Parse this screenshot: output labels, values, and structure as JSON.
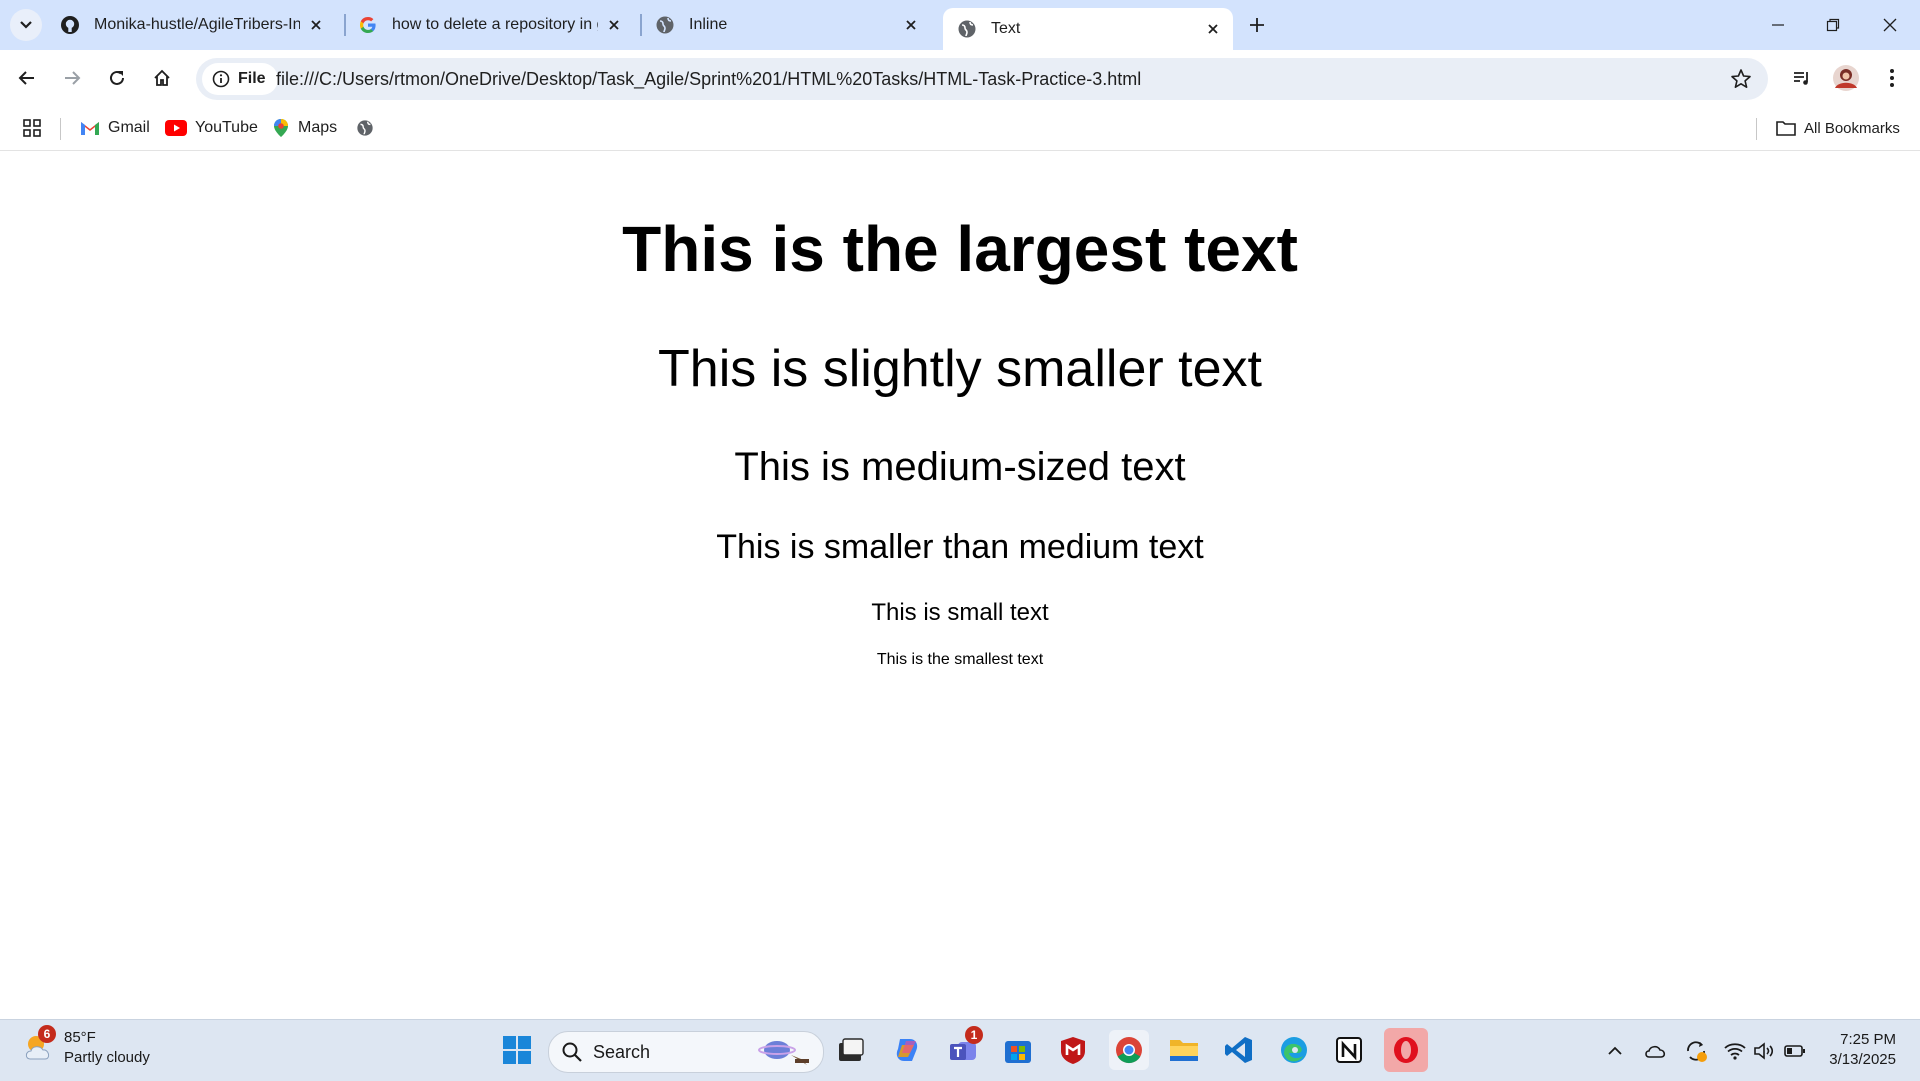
{
  "tabs": [
    {
      "title": "Monika-hustle/AgileTribers-Inte",
      "favicon": "github-icon"
    },
    {
      "title": "how to delete a repository in gi",
      "favicon": "google-icon"
    },
    {
      "title": "Inline",
      "favicon": "globe-icon"
    },
    {
      "title": "Text",
      "favicon": "globe-icon",
      "active": true
    }
  ],
  "omnibox": {
    "chip_label": "File",
    "url": "file:///C:/Users/rtmon/OneDrive/Desktop/Task_Agile/Sprint%201/HTML%20Tasks/HTML-Task-Practice-3.html"
  },
  "bookmarks": {
    "items": [
      {
        "label": "Gmail",
        "icon": "gmail-icon"
      },
      {
        "label": "YouTube",
        "icon": "youtube-icon"
      },
      {
        "label": "Maps",
        "icon": "maps-icon"
      }
    ],
    "all_label": "All Bookmarks"
  },
  "page": {
    "h1": "This is the largest text",
    "h2": "This is slightly smaller text",
    "h3": "This is medium-sized text",
    "h4": "This is smaller than medium text",
    "h5": "This is small text",
    "h6": "This is the smallest text"
  },
  "taskbar": {
    "weather_badge": "6",
    "temperature": "85°F",
    "condition": "Partly cloudy",
    "search_label": "Search",
    "teams_badge": "1",
    "time": "7:25 PM",
    "date": "3/13/2025"
  },
  "colors": {
    "tabstrip": "#d3e3fd",
    "omnibox": "#e9eef6",
    "taskbar": "#dde6f2",
    "text": "#000000"
  }
}
